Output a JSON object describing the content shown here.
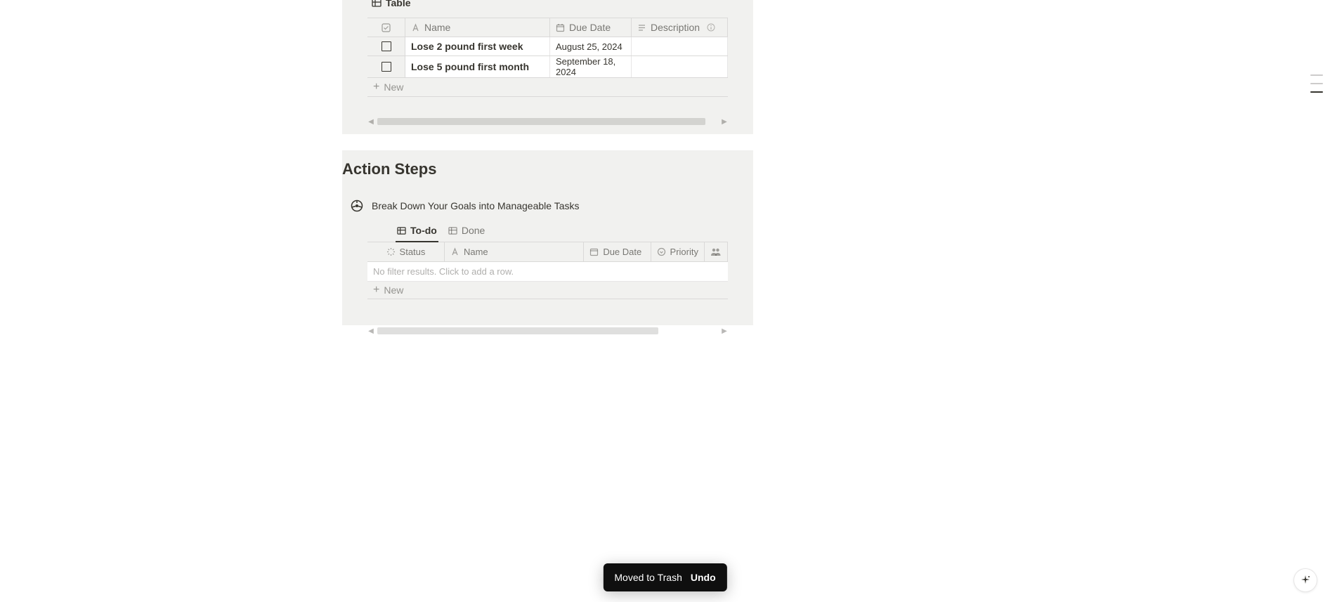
{
  "milestones": {
    "tab_label": "Table",
    "columns": {
      "name": "Name",
      "due_date": "Due Date",
      "description": "Description"
    },
    "rows": [
      {
        "name": "Lose 2 pound first week",
        "due_date": "August 25, 2024",
        "description": ""
      },
      {
        "name": "Lose 5 pound first month",
        "due_date": "September 18, 2024",
        "description": ""
      }
    ],
    "new_label": "New"
  },
  "action_steps": {
    "title": "Action Steps",
    "callout": "Break Down Your Goals into Manageable Tasks",
    "tabs": {
      "todo": "To-do",
      "done": "Done"
    },
    "columns": {
      "status": "Status",
      "name": "Name",
      "due_date": "Due Date",
      "priority": "Priority"
    },
    "empty_text": "No filter results. Click to add a row.",
    "new_label": "New"
  },
  "toast": {
    "message": "Moved to Trash",
    "undo": "Undo"
  }
}
